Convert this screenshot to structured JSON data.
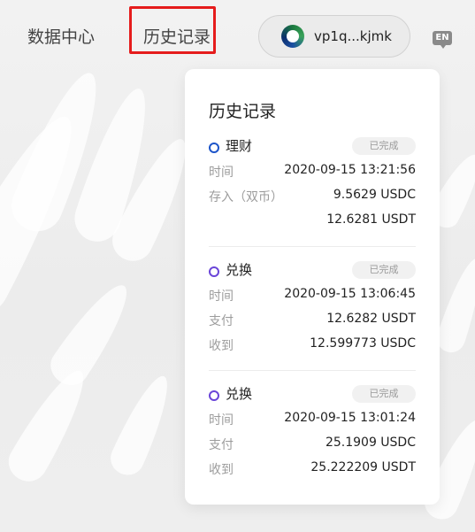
{
  "nav": {
    "data_center": "数据中心",
    "history": "历史记录"
  },
  "wallet": {
    "address": "vp1q...kjmk",
    "icon": "wallet-logo-icon"
  },
  "language": {
    "label": "EN"
  },
  "panel": {
    "title": "历史记录",
    "records": [
      {
        "type": "理财",
        "status": "已完成",
        "dot_color": "#1d55c9",
        "time_label": "时间",
        "time": "2020-09-15 13:21:56",
        "label_2": "存入（双币）",
        "value_2": "9.5629 USDC",
        "label_3": "",
        "value_3": "12.6281 USDT"
      },
      {
        "type": "兑换",
        "status": "已完成",
        "dot_color": "#6a45d8",
        "time_label": "时间",
        "time": "2020-09-15 13:06:45",
        "label_2": "支付",
        "value_2": "12.6282 USDT",
        "label_3": "收到",
        "value_3": "12.599773 USDC"
      },
      {
        "type": "兑换",
        "status": "已完成",
        "dot_color": "#6a45d8",
        "time_label": "时间",
        "time": "2020-09-15 13:01:24",
        "label_2": "支付",
        "value_2": "25.1909 USDC",
        "label_3": "收到",
        "value_3": "25.222209 USDT"
      }
    ]
  },
  "colors": {
    "highlight": "#e51c1c",
    "badge_bg": "#f1f1f1",
    "label": "#9c9c9c"
  }
}
